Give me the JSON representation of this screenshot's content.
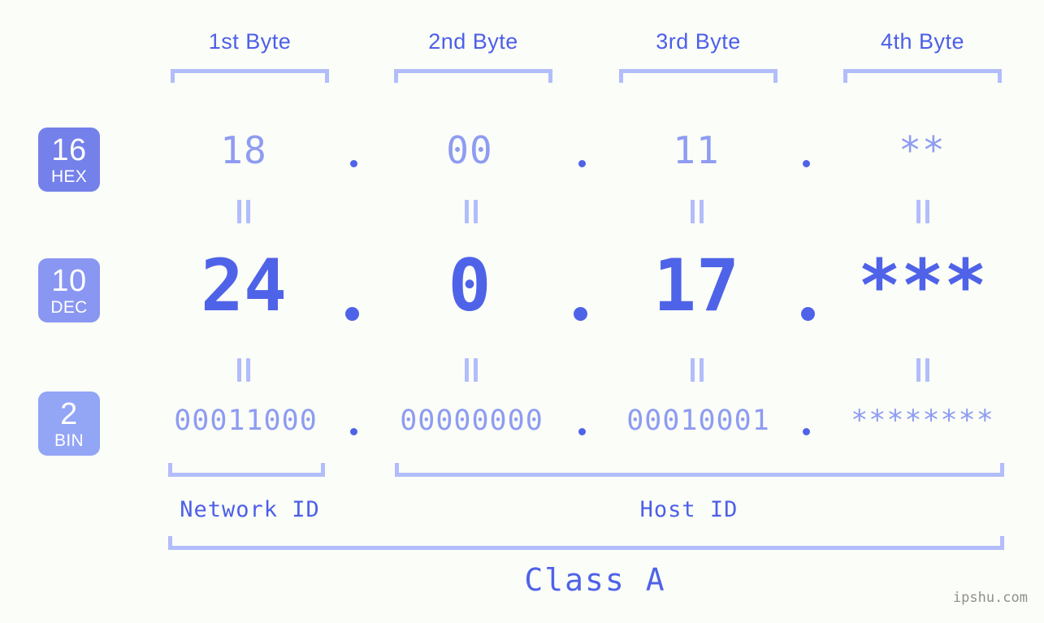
{
  "meta": {
    "background_color": "#fbfdf8",
    "accent_color": "#4f63e8",
    "light_accent_color": "#8e9cf2",
    "bracket_color": "#b2bdfb",
    "watermark": "ipshu.com"
  },
  "byte_headers": [
    {
      "label": "1st Byte"
    },
    {
      "label": "2nd Byte"
    },
    {
      "label": "3rd Byte"
    },
    {
      "label": "4th Byte"
    }
  ],
  "bases": [
    {
      "number": "16",
      "abbr": "HEX",
      "color": "#7481ea"
    },
    {
      "number": "10",
      "abbr": "DEC",
      "color": "#8997f2"
    },
    {
      "number": "2",
      "abbr": "BIN",
      "color": "#93a5f5"
    }
  ],
  "rows": {
    "hex": {
      "base_number": "16",
      "base_abbr": "HEX",
      "values": [
        "18",
        "00",
        "11",
        "**"
      ],
      "separator": "."
    },
    "dec": {
      "base_number": "10",
      "base_abbr": "DEC",
      "values": [
        "24",
        "0",
        "17",
        "***"
      ],
      "separator": "."
    },
    "bin": {
      "base_number": "2",
      "base_abbr": "BIN",
      "values": [
        "00011000",
        "00000000",
        "00010001",
        "********"
      ],
      "separator": "."
    }
  },
  "equals_marker": "=",
  "segments": {
    "network_id": "Network ID",
    "host_id": "Host ID",
    "class": "Class A"
  }
}
